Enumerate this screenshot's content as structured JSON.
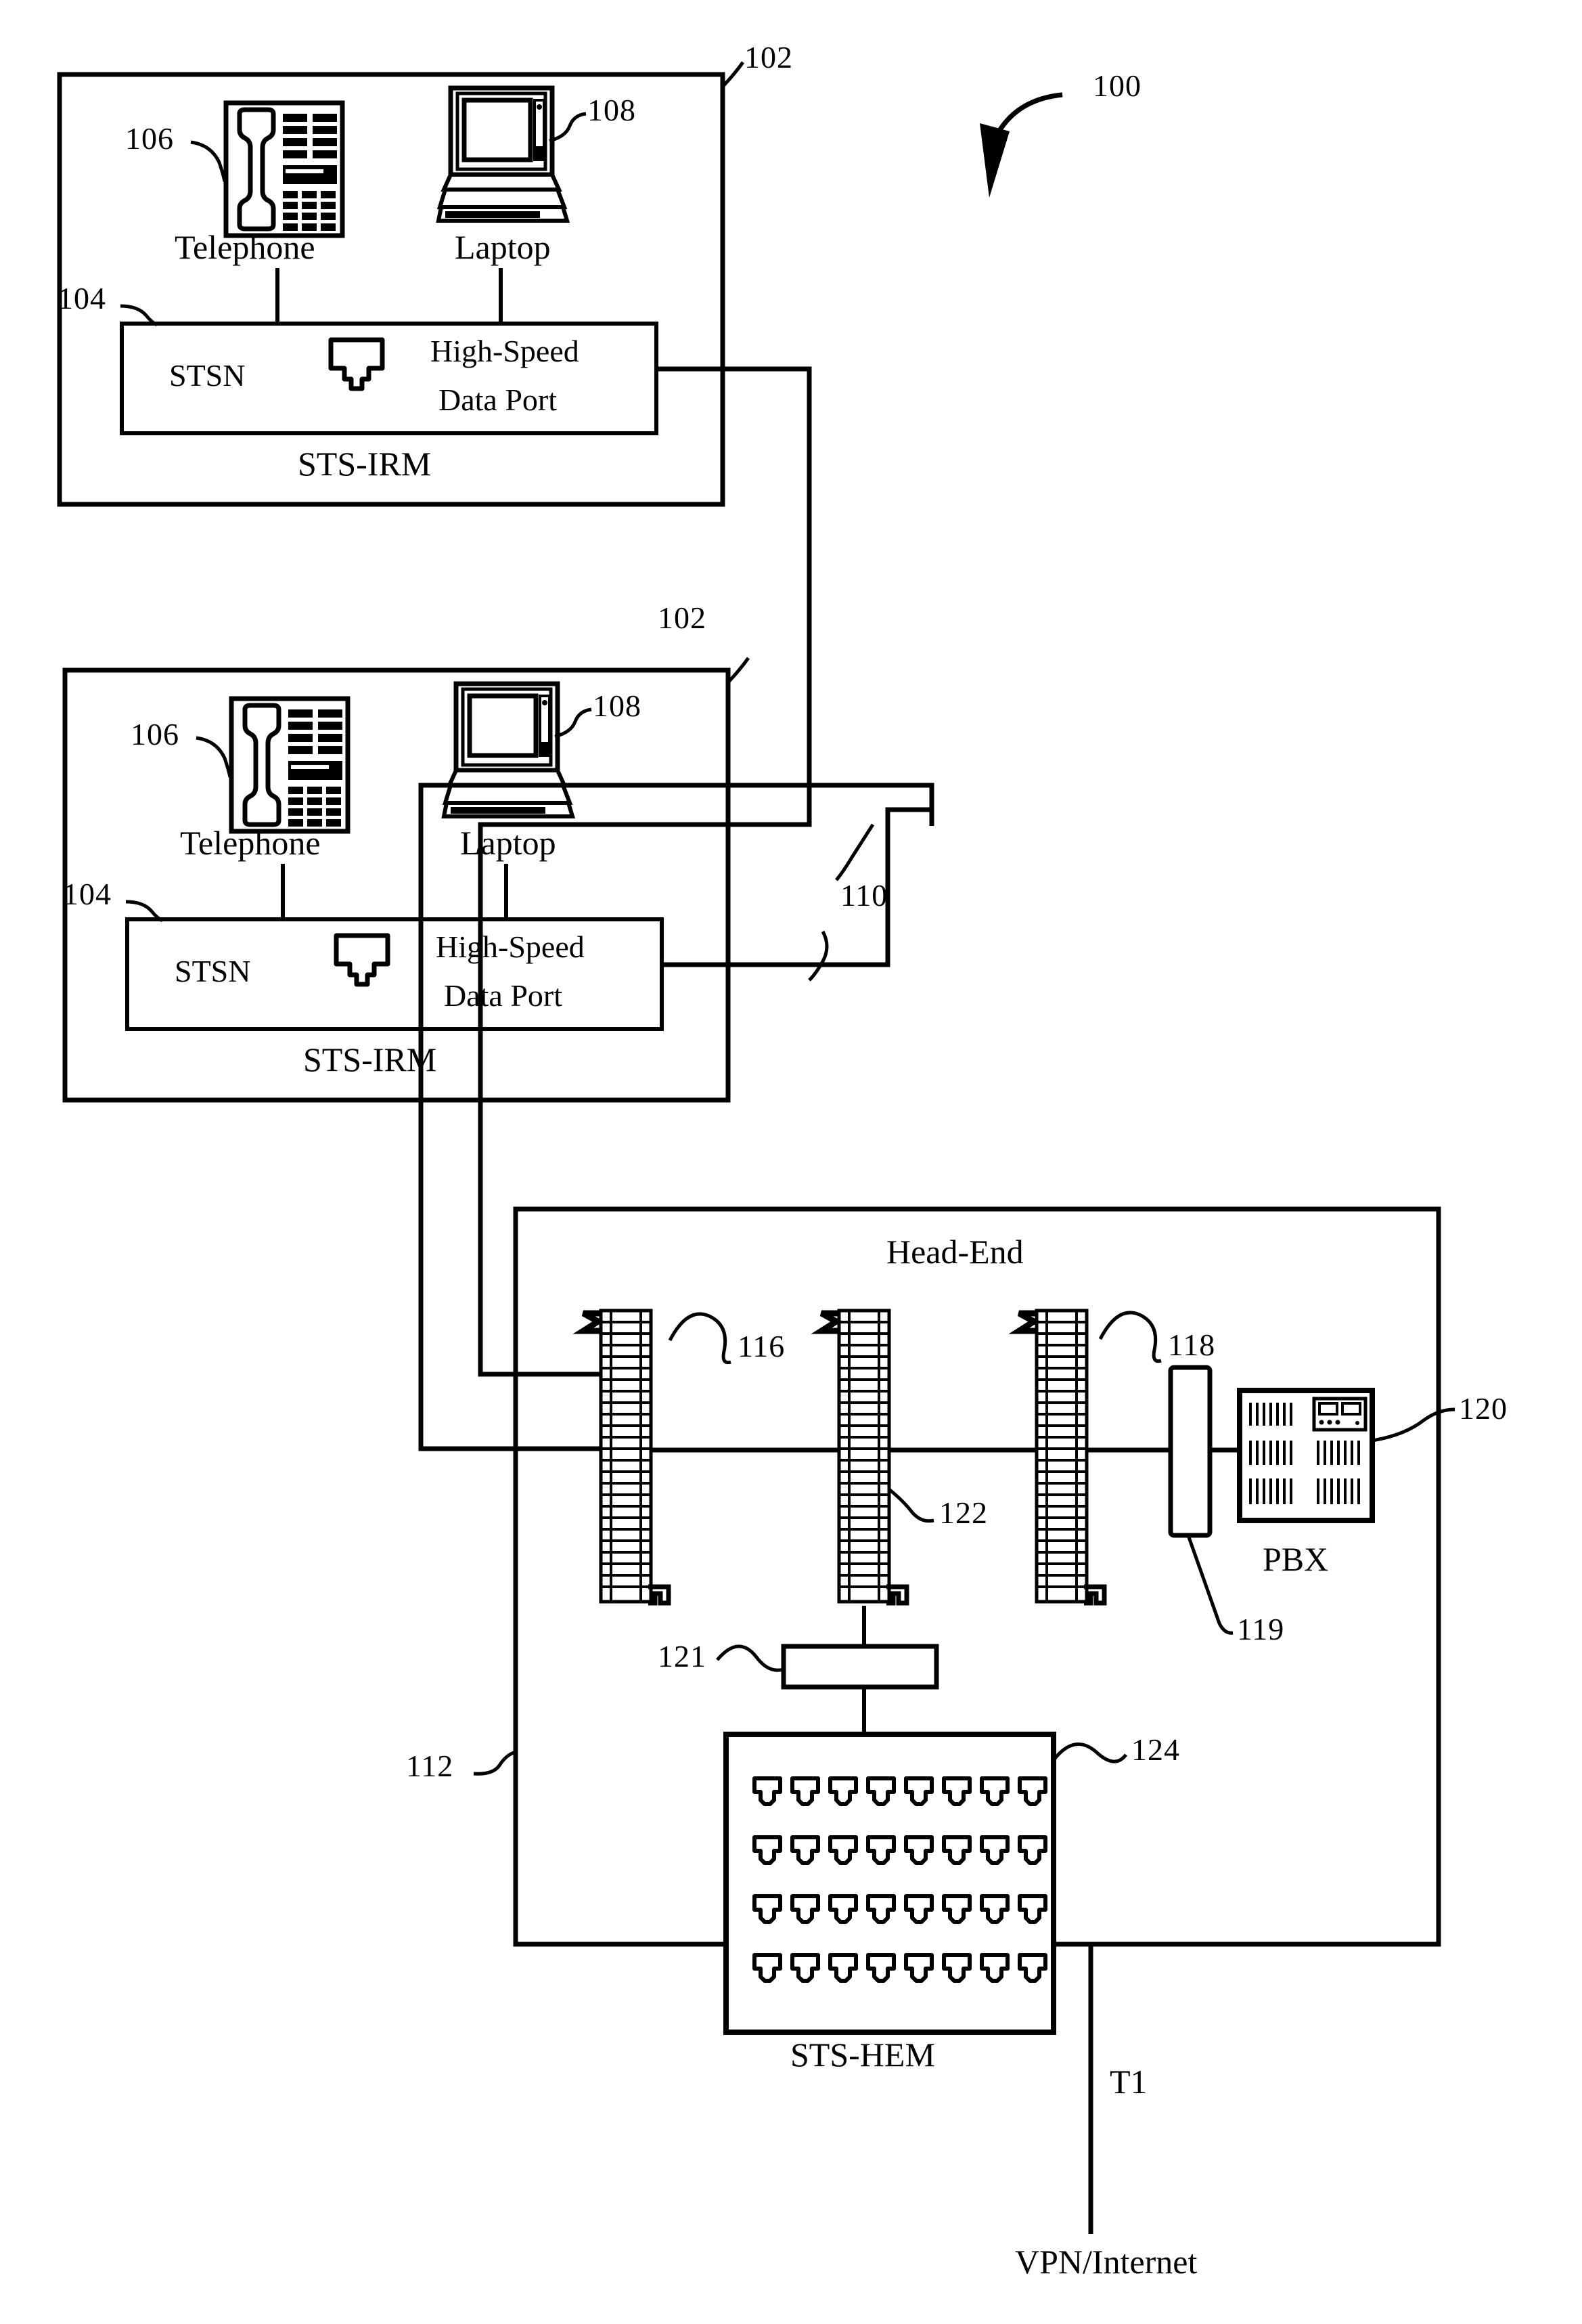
{
  "figure": {
    "title_ref": "100",
    "type": "patent-network-diagram"
  },
  "rooms": [
    {
      "ref": "102",
      "enclosure_label": "STS-IRM",
      "devices": [
        {
          "ref": "106",
          "label": "Telephone",
          "icon": "telephone-icon"
        },
        {
          "ref": "108",
          "label": "Laptop",
          "icon": "laptop-icon"
        }
      ],
      "module": {
        "ref": "104",
        "left_label": "STSN",
        "jack_icon": "rj45-jack-icon",
        "right_label_line1": "High-Speed",
        "right_label_line2": "Data Port"
      }
    },
    {
      "ref": "102",
      "enclosure_label": "STS-IRM",
      "devices": [
        {
          "ref": "106",
          "label": "Telephone",
          "icon": "telephone-icon"
        },
        {
          "ref": "108",
          "label": "Laptop",
          "icon": "laptop-icon"
        }
      ],
      "module": {
        "ref": "104",
        "left_label": "STSN",
        "jack_icon": "rj45-jack-icon",
        "right_label_line1": "High-Speed",
        "right_label_line2": "Data Port"
      }
    }
  ],
  "cabling": {
    "riser_ref": "110"
  },
  "head_end": {
    "ref": "112",
    "label": "Head-End",
    "punch_blocks": [
      {
        "ref": "116",
        "name": "punch-block-1"
      },
      {
        "ref": "122",
        "name": "punch-block-2"
      },
      {
        "ref": "118",
        "name": "punch-block-3"
      }
    ],
    "interface_module": {
      "ref": "119",
      "name": "interface-module"
    },
    "pbx": {
      "ref": "120",
      "label": "PBX"
    },
    "connector_bar": {
      "ref": "121",
      "name": "connector-bar"
    },
    "hem": {
      "ref": "124",
      "label": "STS-HEM",
      "jack_rows": 4,
      "jack_cols": 8
    }
  },
  "uplink": {
    "line_label": "T1",
    "destination_label": "VPN/Internet"
  },
  "colors": {
    "ink": "#000000",
    "paper": "#ffffff"
  }
}
